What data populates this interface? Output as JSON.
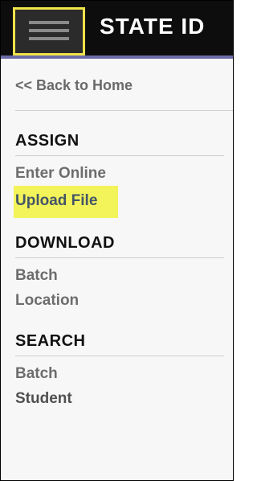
{
  "header": {
    "title": "STATE ID",
    "menu_icon": "hamburger-menu-icon"
  },
  "nav": {
    "back_label": "<< Back to Home"
  },
  "sections": {
    "assign": {
      "title": "ASSIGN",
      "items": [
        "Enter Online",
        "Upload File"
      ]
    },
    "download": {
      "title": "DOWNLOAD",
      "items": [
        "Batch",
        "Location"
      ]
    },
    "search": {
      "title": "SEARCH",
      "items": [
        "Batch",
        "Student"
      ]
    }
  },
  "colors": {
    "header_bg": "#0d0d0d",
    "header_underline": "#6b6ba8",
    "highlight": "#f3f35a",
    "menu_outline": "#f2e24a"
  }
}
